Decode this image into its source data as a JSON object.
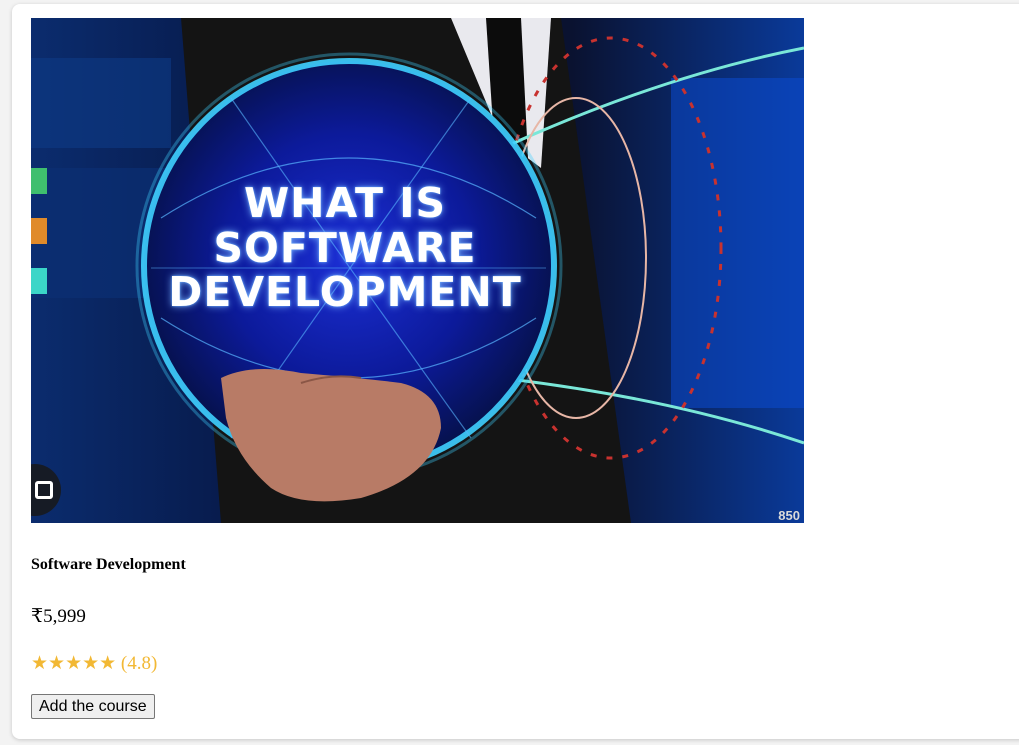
{
  "course": {
    "image_alt": "What is Software Development",
    "image_text": {
      "line1": "WHAT IS",
      "line2": "SOFTWARE",
      "line3": "DEVELOPMENT"
    },
    "image_size_label": "850",
    "title": "Software Development",
    "price": "₹5,999",
    "stars": "★★★★★",
    "rating": "(4.8)",
    "rating_value": 4.8,
    "add_button_label": "Add the course"
  },
  "colors": {
    "star": "#f2b834",
    "image_background": "#030a2e",
    "globe_glow": "#3fd0ff"
  }
}
